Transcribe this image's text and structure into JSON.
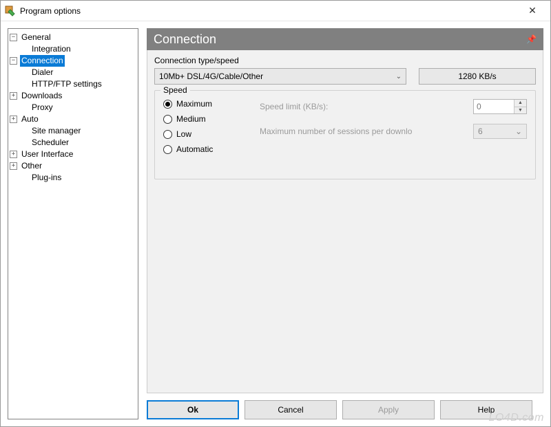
{
  "window": {
    "title": "Program options"
  },
  "tree": {
    "general": {
      "label": "General",
      "expanded": true,
      "integration": "Integration"
    },
    "connection": {
      "label": "Connection",
      "expanded": true,
      "dialer": "Dialer",
      "http": "HTTP/FTP settings"
    },
    "downloads": {
      "label": "Downloads",
      "expanded": false,
      "proxy": "Proxy"
    },
    "auto": {
      "label": "Auto",
      "expanded": false,
      "site_manager": "Site manager",
      "scheduler": "Scheduler"
    },
    "ui": {
      "label": "User Interface",
      "expanded": false
    },
    "other": {
      "label": "Other",
      "expanded": false,
      "plugins": "Plug-ins"
    }
  },
  "panel": {
    "title": "Connection",
    "conn_type_label": "Connection type/speed",
    "conn_type_value": "10Mb+ DSL/4G/Cable/Other",
    "rate": "1280 KB/s",
    "speed_group": "Speed",
    "radios": {
      "maximum": "Maximum",
      "medium": "Medium",
      "low": "Low",
      "automatic": "Automatic",
      "selected": "maximum"
    },
    "speed_limit_label": "Speed limit (KB/s):",
    "speed_limit_value": "0",
    "max_sessions_label": "Maximum number of sessions per downlo",
    "max_sessions_value": "6"
  },
  "buttons": {
    "ok": "Ok",
    "cancel": "Cancel",
    "apply": "Apply",
    "help": "Help"
  },
  "watermark": "LO4D.com"
}
